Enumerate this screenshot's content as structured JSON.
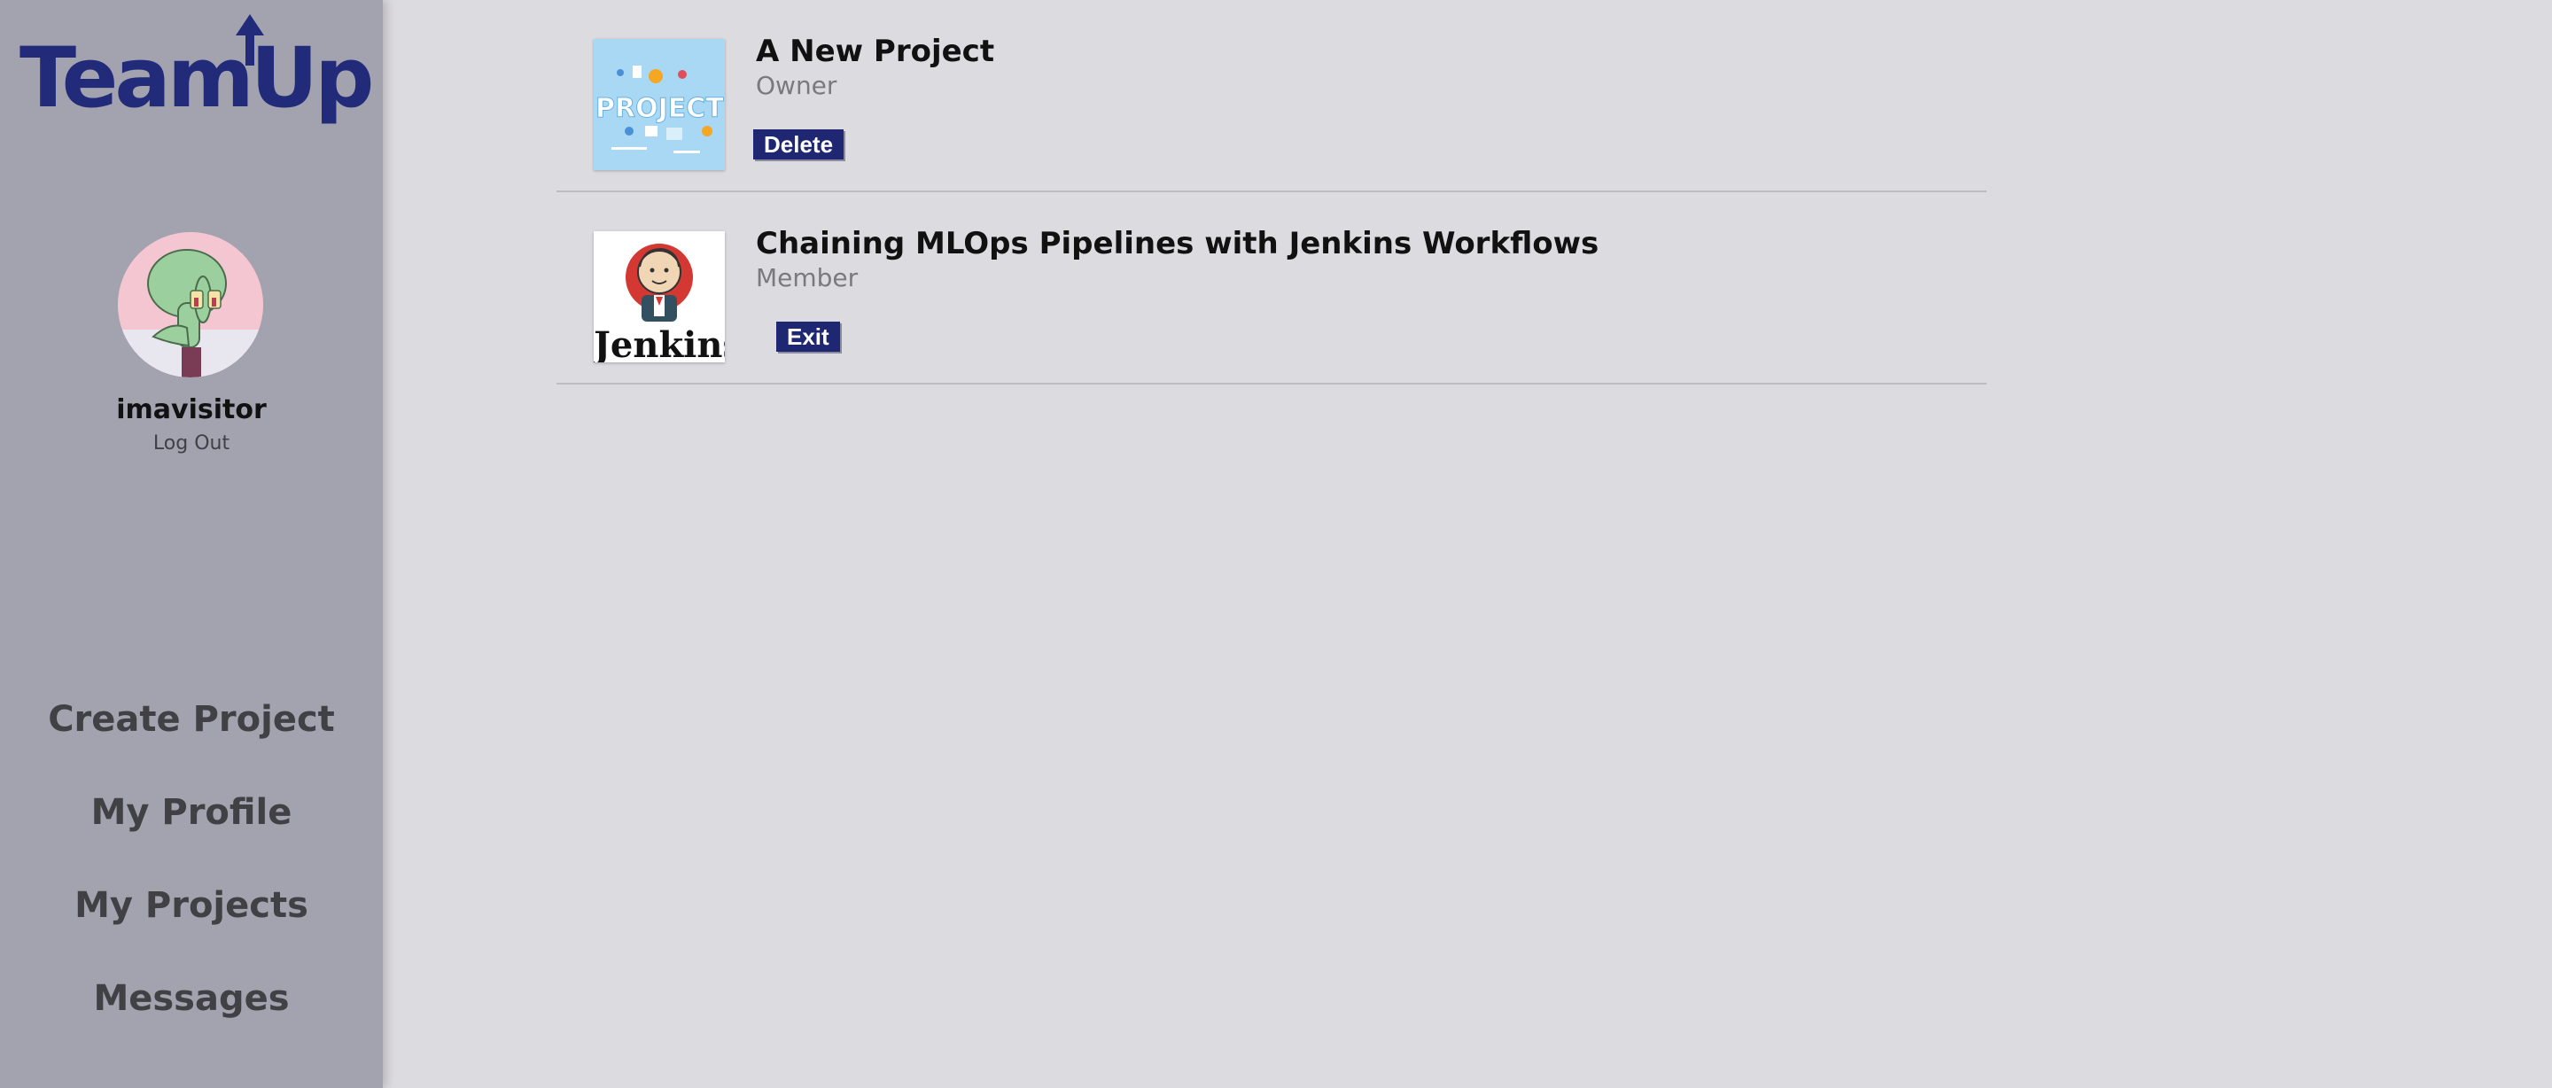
{
  "brand": {
    "logo_text": "TeamUp",
    "color": "#222a7a"
  },
  "user": {
    "username": "imavisitor",
    "logout_label": "Log Out"
  },
  "nav": {
    "items": [
      {
        "label": "Create Project"
      },
      {
        "label": "My Profile"
      },
      {
        "label": "My Projects"
      },
      {
        "label": "Messages"
      }
    ]
  },
  "projects": [
    {
      "title": "A New Project",
      "role": "Owner",
      "action_label": "Delete",
      "thumb_text": "PROJECT"
    },
    {
      "title": "Chaining MLOps Pipelines with Jenkins Workflows",
      "role": "Member",
      "action_label": "Exit",
      "thumb_text": "Jenkins"
    }
  ],
  "colors": {
    "sidebar": "#a2a3af",
    "background": "#dcdbe0",
    "button": "#1f2672"
  }
}
